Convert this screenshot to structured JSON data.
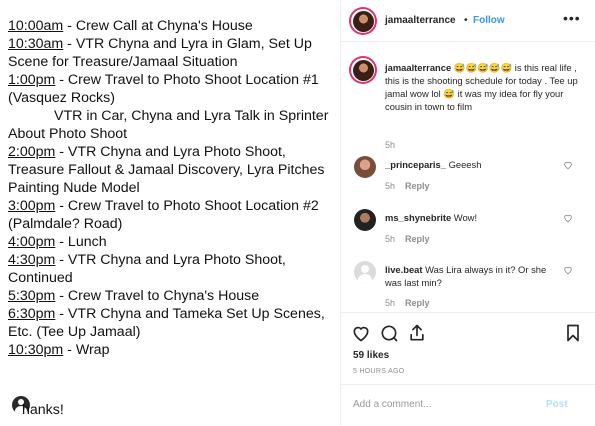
{
  "schedule": {
    "lines": [
      {
        "time": "10:00am",
        "text": " - Crew Call at Chyna's House"
      },
      {
        "time": "10:30am",
        "text": " - VTR Chyna and Lyra in Glam, Set Up"
      },
      {
        "time": "",
        "text": "Scene for Treasure/Jamaal Situation"
      },
      {
        "time": "1:00pm",
        "text": " - Crew Travel to Photo Shoot Location #1"
      },
      {
        "time": "",
        "text": "(Vasquez Rocks)"
      },
      {
        "time": "",
        "text": "VTR in Car, Chyna and Lyra Talk in Sprinter",
        "indent": true
      },
      {
        "time": "",
        "text": "About Photo Shoot"
      },
      {
        "time": "2:00pm",
        "text": " - VTR Chyna and Lyra Photo Shoot,"
      },
      {
        "time": "",
        "text": "Treasure Fallout & Jamaal Discovery, Lyra Pitches"
      },
      {
        "time": "",
        "text": "Painting Nude Model"
      },
      {
        "time": "3:00pm",
        "text": " - Crew Travel to Photo Shoot Location #2"
      },
      {
        "time": "",
        "text": "(Palmdale? Road)"
      },
      {
        "time": "4:00pm",
        "text": " - Lunch"
      },
      {
        "time": "4:30pm",
        "text": " - VTR Chyna and Lyra Photo Shoot,"
      },
      {
        "time": "",
        "text": "Continued"
      },
      {
        "time": "5:30pm",
        "text": " - Crew Travel to Chyna's House"
      },
      {
        "time": "6:30pm",
        "text": " - VTR Chyna and Tameka Set Up Scenes,"
      },
      {
        "time": "",
        "text": "Etc. (Tee Up Jamaal)"
      },
      {
        "time": "10:30pm",
        "text": " - Wrap"
      }
    ],
    "thanks": "hanks!"
  },
  "post": {
    "username": "jamaalterrance",
    "separator": "•",
    "follow": "Follow",
    "more": "•••",
    "caption_user": "jamaalterrance",
    "caption_text": " 😅😅😅😅😅 is this real life , this is the shooting schedule for today . Tee up jamal wow lol 😅 it was my idea for fly your cousin in town to film",
    "caption_time": "5h"
  },
  "comments": [
    {
      "user": "_princeparis_",
      "text": " Geeesh",
      "time": "5h",
      "reply": "Reply"
    },
    {
      "user": "ms_shynebrite",
      "text": " Wow!",
      "time": "5h",
      "reply": "Reply"
    },
    {
      "user": "live.beat",
      "text": " Was Lira always in it? Or she was last min?",
      "time": "5h",
      "reply": "Reply"
    }
  ],
  "actions": {
    "likes": "59 likes",
    "ago": "5 HOURS AGO"
  },
  "add_comment": {
    "placeholder": "Add a comment...",
    "post": "Post"
  },
  "colors": {
    "link_blue": "#3897f0",
    "post_disabled": "#b2dffc",
    "secondary_text": "#8e8e8e",
    "story_ring": "#e1306c"
  }
}
